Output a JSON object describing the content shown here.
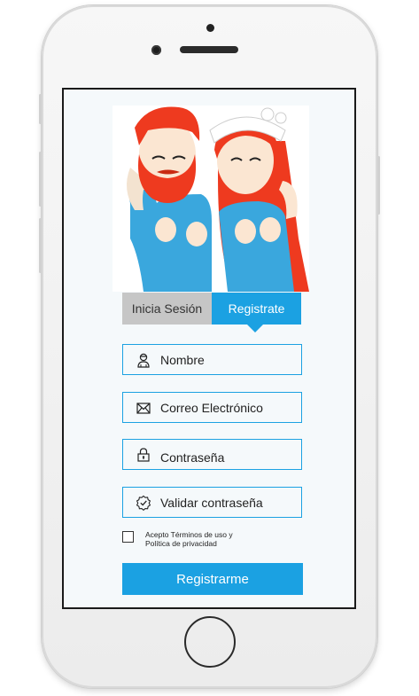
{
  "tabs": {
    "login_label": "Inicia Sesión",
    "register_label": "Registrate",
    "active": "register"
  },
  "form": {
    "name_placeholder": "Nombre",
    "email_placeholder": "Correo Electrónico",
    "password_placeholder": "Contraseña",
    "confirm_placeholder": "Validar contraseña",
    "terms_line1": "Acepto Términos de uso  y",
    "terms_line2": "Política de privacidad",
    "terms_checked": false,
    "submit_label": "Registrarme"
  },
  "colors": {
    "accent": "#1ba1e2",
    "inactive_tab": "#c6c6c6",
    "hair": "#ee3a1f",
    "shirt": "#3aa7dd"
  },
  "icons": {
    "name": "user-icon",
    "email": "envelope-icon",
    "password": "lock-icon",
    "confirm": "check-badge-icon"
  }
}
